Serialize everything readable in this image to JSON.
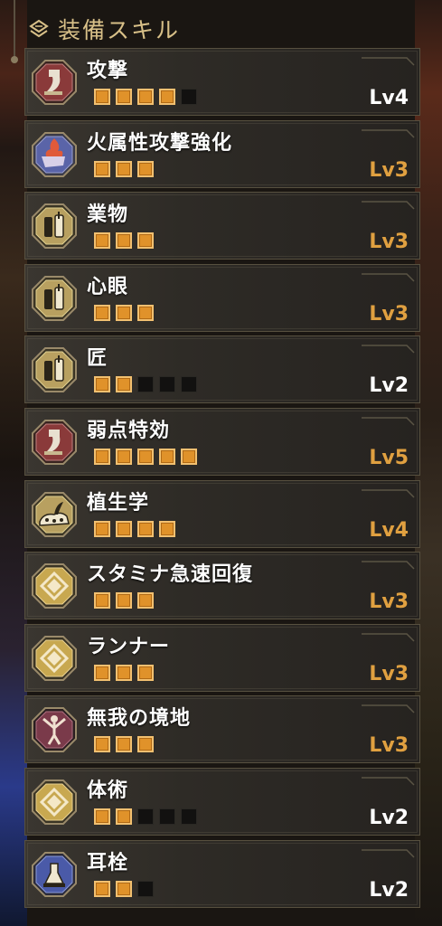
{
  "header": {
    "title": "装備スキル",
    "icon": "layers-icon"
  },
  "colors": {
    "max_level": "#e0a040",
    "normal_level": "#ffffff",
    "pip_on": "#e0922a",
    "pip_off": "#121110"
  },
  "skills": [
    {
      "name": "攻撃",
      "level": "Lv4",
      "pips_on": 4,
      "pips_total": 5,
      "icon": "attack-blade-icon",
      "maxed": false
    },
    {
      "name": "火属性攻撃強化",
      "level": "Lv3",
      "pips_on": 3,
      "pips_total": 3,
      "icon": "fire-attack-icon",
      "maxed": true
    },
    {
      "name": "業物",
      "level": "Lv3",
      "pips_on": 3,
      "pips_total": 3,
      "icon": "whetstone-icon",
      "maxed": true
    },
    {
      "name": "心眼",
      "level": "Lv3",
      "pips_on": 3,
      "pips_total": 3,
      "icon": "whetstone-icon",
      "maxed": true
    },
    {
      "name": "匠",
      "level": "Lv2",
      "pips_on": 2,
      "pips_total": 5,
      "icon": "whetstone-icon",
      "maxed": false
    },
    {
      "name": "弱点特効",
      "level": "Lv5",
      "pips_on": 5,
      "pips_total": 5,
      "icon": "attack-blade-icon",
      "maxed": true
    },
    {
      "name": "植生学",
      "level": "Lv4",
      "pips_on": 4,
      "pips_total": 4,
      "icon": "plant-icon",
      "maxed": true
    },
    {
      "name": "スタミナ急速回復",
      "level": "Lv3",
      "pips_on": 3,
      "pips_total": 3,
      "icon": "stamina-diamond-icon",
      "maxed": true
    },
    {
      "name": "ランナー",
      "level": "Lv3",
      "pips_on": 3,
      "pips_total": 3,
      "icon": "stamina-diamond-icon",
      "maxed": true
    },
    {
      "name": "無我の境地",
      "level": "Lv3",
      "pips_on": 3,
      "pips_total": 3,
      "icon": "spirit-figure-icon",
      "maxed": true
    },
    {
      "name": "体術",
      "level": "Lv2",
      "pips_on": 2,
      "pips_total": 5,
      "icon": "stamina-diamond-icon",
      "maxed": false
    },
    {
      "name": "耳栓",
      "level": "Lv2",
      "pips_on": 2,
      "pips_total": 3,
      "icon": "earplug-icon",
      "maxed": false
    }
  ]
}
